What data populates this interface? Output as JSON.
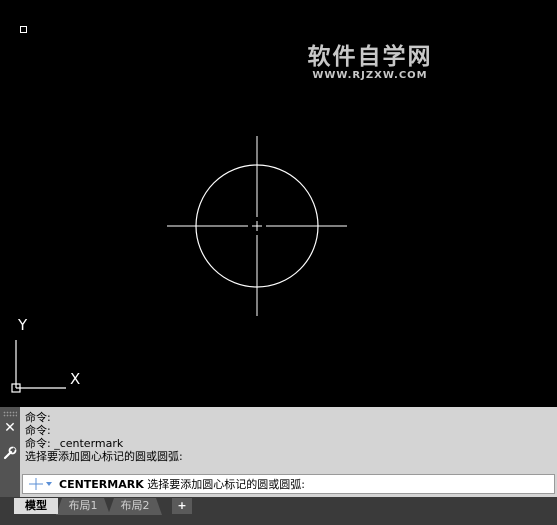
{
  "watermark": {
    "cn": "软件自学网",
    "en": "WWW.RJZXW.COM"
  },
  "ucs": {
    "x_label": "X",
    "y_label": "Y"
  },
  "command_line": {
    "history": [
      "命令:",
      "命令:",
      "命令: _centermark",
      "选择要添加圆心标记的圆或圆弧:"
    ],
    "input_command": "CENTERMARK",
    "input_prompt": " 选择要添加圆心标记的圆或圆弧:",
    "close_icon": "close-icon",
    "customize_icon": "wrench-icon"
  },
  "layout_tabs": {
    "tabs": [
      "模型",
      "布局1",
      "布局2"
    ],
    "active": "模型",
    "add_label": "+"
  },
  "colors": {
    "canvas_background": "#000000",
    "geometry": "#ffffff",
    "command_panel": "#d4d4d4",
    "tab_bar": "#3a3a3a"
  }
}
